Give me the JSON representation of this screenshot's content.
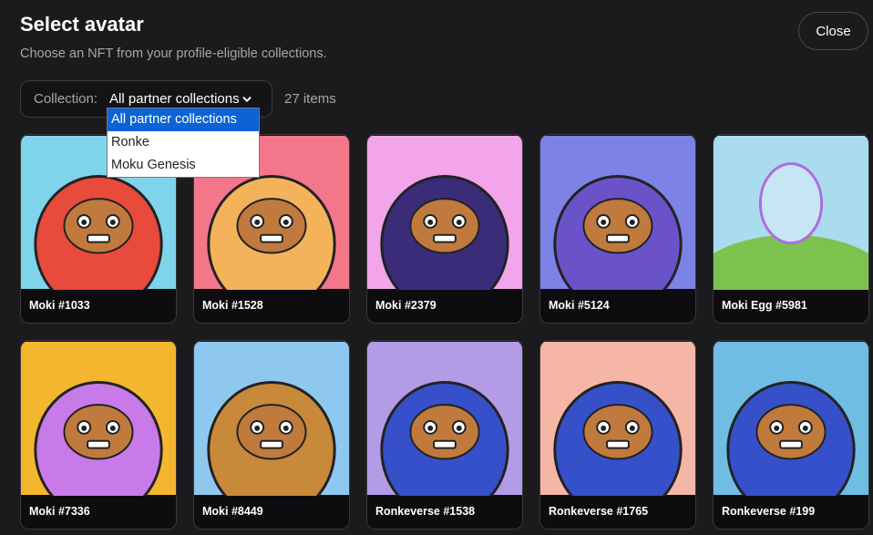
{
  "header": {
    "title": "Select avatar",
    "subtitle": "Choose an NFT from your profile-eligible collections.",
    "close_label": "Close"
  },
  "filter": {
    "label": "Collection:",
    "selected": "All partner collections",
    "count": "27 items",
    "options": [
      "All partner collections",
      "Ronke",
      "Moku Genesis"
    ]
  },
  "items": [
    {
      "name": "Moki #1033",
      "bg": "#7fd3ea",
      "char": "#e84a3c"
    },
    {
      "name": "Moki #1528",
      "bg": "#f3768a",
      "char": "#f4b35a"
    },
    {
      "name": "Moki #2379",
      "bg": "#f2a5ea",
      "char": "#3b2c7a"
    },
    {
      "name": "Moki #5124",
      "bg": "#7c82e6",
      "char": "#6a52c9"
    },
    {
      "name": "Moki Egg #5981",
      "bg": "#a9dcef",
      "char": "#c6e6f5"
    },
    {
      "name": "Moki #7336",
      "bg": "#f4b62f",
      "char": "#c87be8"
    },
    {
      "name": "Moki #8449",
      "bg": "#8fc8ee",
      "char": "#c8893a"
    },
    {
      "name": "Ronkeverse #1538",
      "bg": "#b49be6",
      "char": "#3650c9"
    },
    {
      "name": "Ronkeverse #1765",
      "bg": "#f5b6a6",
      "char": "#3650c9"
    },
    {
      "name": "Ronkeverse #199",
      "bg": "#6fbde3",
      "char": "#3650c9"
    }
  ],
  "colors": {
    "accent": "#0b63d6",
    "background": "#1b1b1d"
  }
}
